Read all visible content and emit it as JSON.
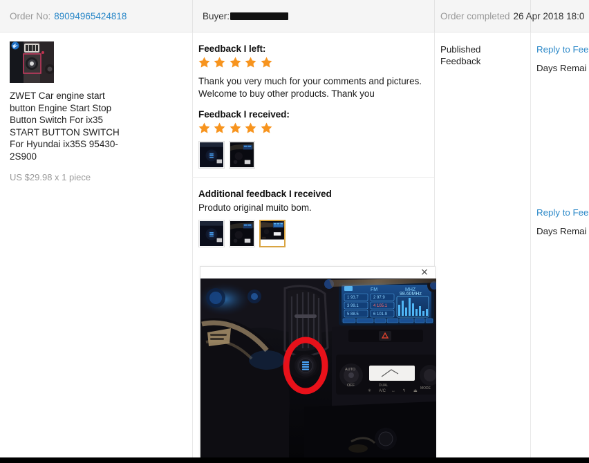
{
  "header": {
    "order_no_label": "Order No:",
    "order_no_value": "89094965424818",
    "buyer_label": "Buyer:",
    "buyer_value_redacted": "",
    "status_label": "Order completed",
    "status_date": "26 Apr 2018 18:0"
  },
  "product": {
    "title": "ZWET Car engine start button Engine Start Stop Button Switch For ix35 START BUTTON SWITCH For Hyundai ix35S 95430-2S900",
    "price": "US $29.98 x 1 piece",
    "thumb_icon": "product-thumbnail-car-start-button"
  },
  "feedback_left": {
    "heading": "Feedback I left:",
    "rating": 5,
    "max_rating": 5,
    "text": "Thank you very much for your comments and pictures. Welcome to buy other products. Thank you"
  },
  "feedback_received": {
    "heading": "Feedback I received:",
    "rating": 5,
    "max_rating": 5,
    "thumbnails": [
      {
        "name": "feedback-thumb-start-button",
        "selected": false
      },
      {
        "name": "feedback-thumb-dashboard",
        "selected": false
      }
    ]
  },
  "additional_feedback": {
    "heading": "Additional feedback I received",
    "text": "Produto original muito bom.",
    "thumbnails": [
      {
        "name": "additional-thumb-start-button",
        "selected": false
      },
      {
        "name": "additional-thumb-steering",
        "selected": false
      },
      {
        "name": "additional-thumb-console",
        "selected": true
      }
    ]
  },
  "status_column": {
    "row1_line1": "Published",
    "row1_line2": "Feedback",
    "row2_line1": "",
    "row2_line2": ""
  },
  "reply_column": {
    "row1_link": "Reply to Fee",
    "row1_days": "Days Remai",
    "row2_link": "Reply to Fee",
    "row2_days": "Days Remai"
  },
  "preview": {
    "close_glyph": "×",
    "image_name": "car-interior-start-button-highlighted",
    "alt": "Car interior dashboard with red circle highlighting engine start stop button"
  },
  "colors": {
    "link": "#2b88c8",
    "star": "#f7941e",
    "muted_text": "#999999",
    "header_bg": "#f5f5f5",
    "selected_border": "#d9a441",
    "highlight_ring": "#e8111a"
  }
}
